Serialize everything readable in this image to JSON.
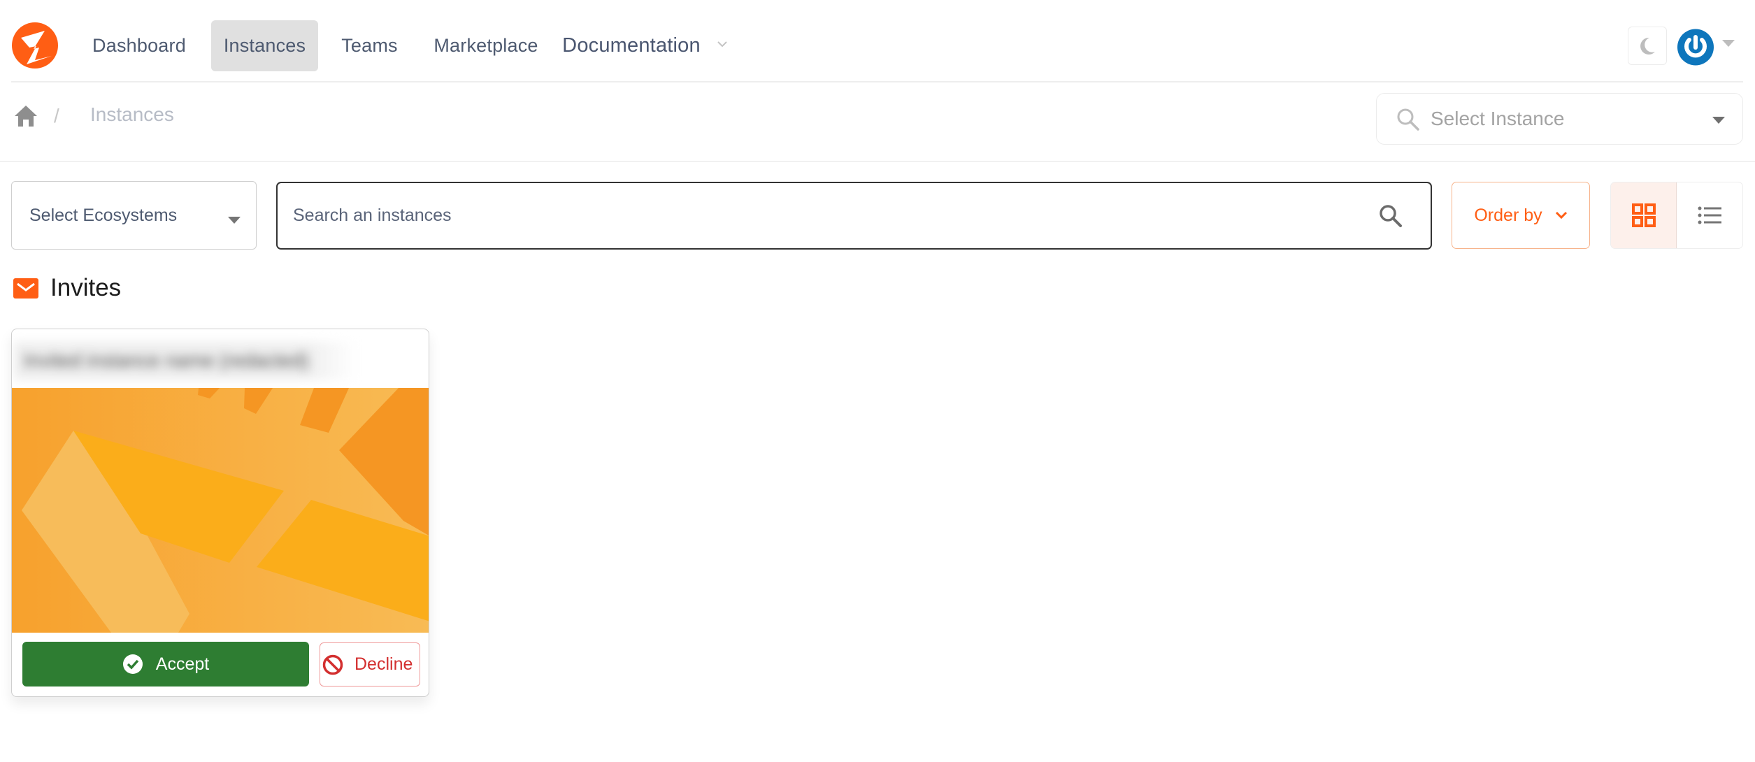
{
  "colors": {
    "brand": "#ff5e14",
    "accept": "#2e7d32",
    "decline": "#d32f2f",
    "avatar": "#0e76bc",
    "nav_active_bg": "#e0e0e0"
  },
  "navbar": {
    "logo_icon": "brand-logo",
    "items": [
      {
        "label": "Dashboard",
        "active": false
      },
      {
        "label": "Instances",
        "active": true
      },
      {
        "label": "Teams",
        "active": false
      },
      {
        "label": "Marketplace",
        "active": false
      },
      {
        "label": "Documentation",
        "active": false,
        "has_dropdown": true
      }
    ],
    "theme_toggle_icon": "moon-icon",
    "avatar_icon": "power-icon"
  },
  "breadcrumb": {
    "home_icon": "home-icon",
    "separator": "/",
    "current": "Instances"
  },
  "instance_select": {
    "placeholder": "Select Instance"
  },
  "filters": {
    "ecosystem_select": {
      "label": "Select Ecosystems"
    },
    "search": {
      "placeholder": "Search an instances",
      "value": ""
    },
    "order_by": {
      "label": "Order by"
    },
    "view_toggle": {
      "options": [
        "grid",
        "list"
      ],
      "selected": "grid"
    }
  },
  "invites": {
    "title": "Invites",
    "icon": "mail-icon",
    "cards": [
      {
        "title": "Invited instance name (redacted)",
        "title_redacted": true,
        "accept_label": "Accept",
        "decline_label": "Decline"
      }
    ]
  }
}
